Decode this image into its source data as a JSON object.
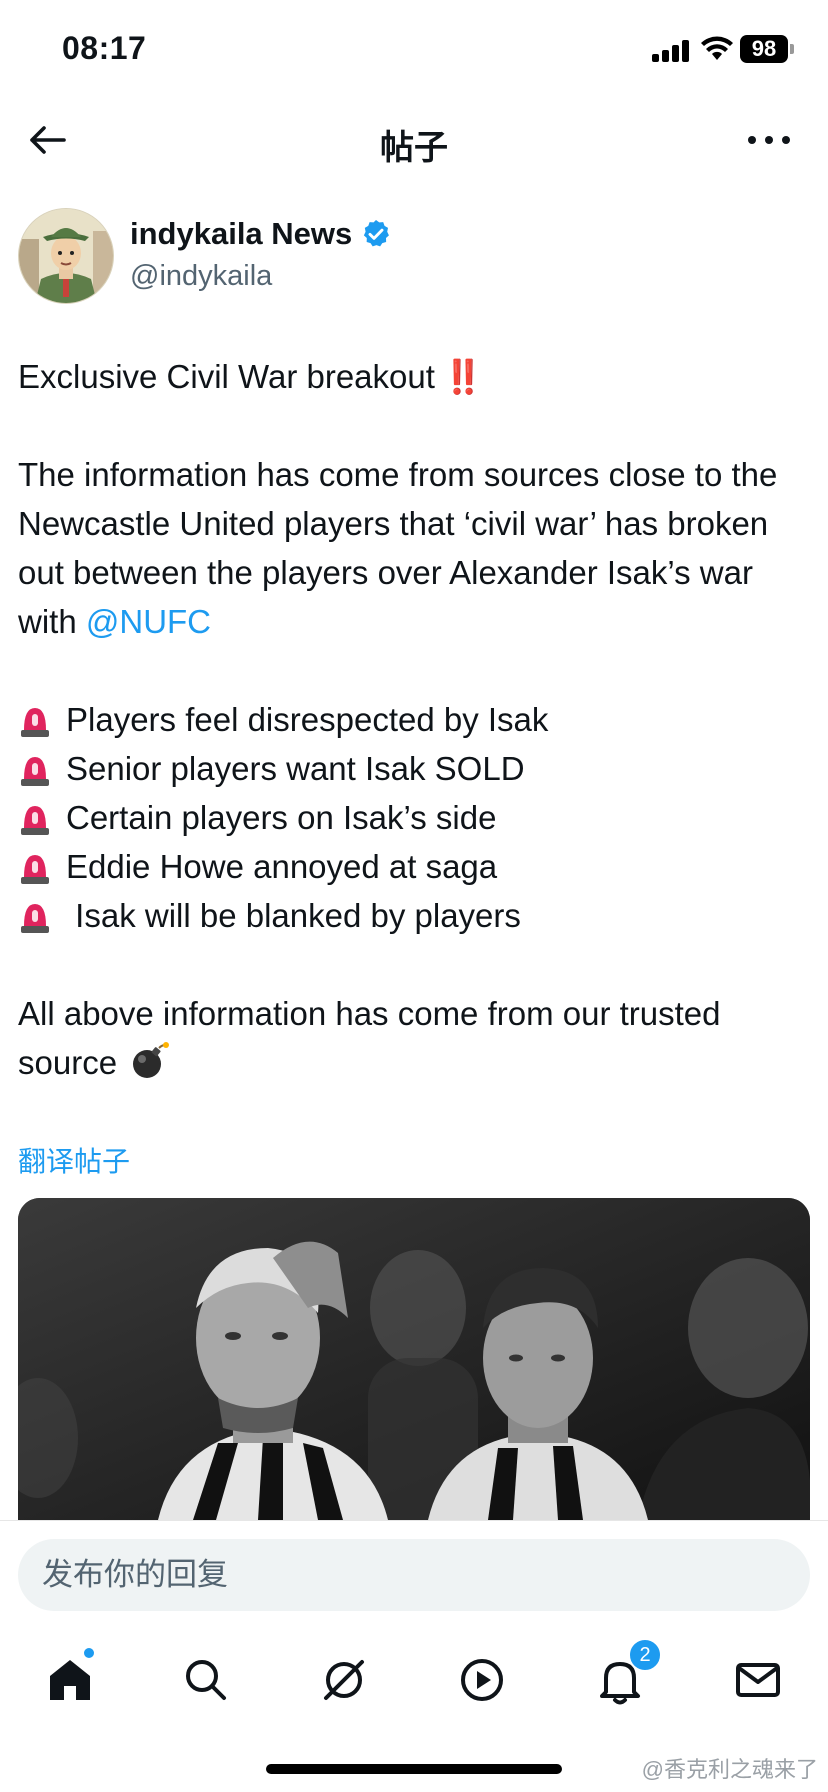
{
  "status_bar": {
    "time": "08:17",
    "battery": "98"
  },
  "header": {
    "title": "帖子"
  },
  "author": {
    "name": "indykaila News",
    "handle": "@indykaila",
    "verified": true
  },
  "post": {
    "headline": "Exclusive Civil War breakout",
    "headline_emoji": "‼️",
    "paragraph_1": "The information has come from sources close to the Newcastle United players that ‘civil war’ has broken out between the players over Alexander Isak’s war with",
    "mention": "@NUFC",
    "bullets": [
      "Players feel disrespected by Isak",
      "Senior players want Isak SOLD",
      "Certain players on Isak’s side",
      "Eddie Howe annoyed at saga",
      " Isak will be blanked by players"
    ],
    "closing": "All above information has come from our trusted source",
    "translate_label": "翻译帖子"
  },
  "reply": {
    "placeholder": "发布你的回复"
  },
  "nav": {
    "notification_count": "2"
  },
  "watermark": "@香克利之魂来了",
  "colors": {
    "accent": "#1d9bf0",
    "text": "#0f1419",
    "secondary": "#536471",
    "siren": "#e0245e"
  }
}
